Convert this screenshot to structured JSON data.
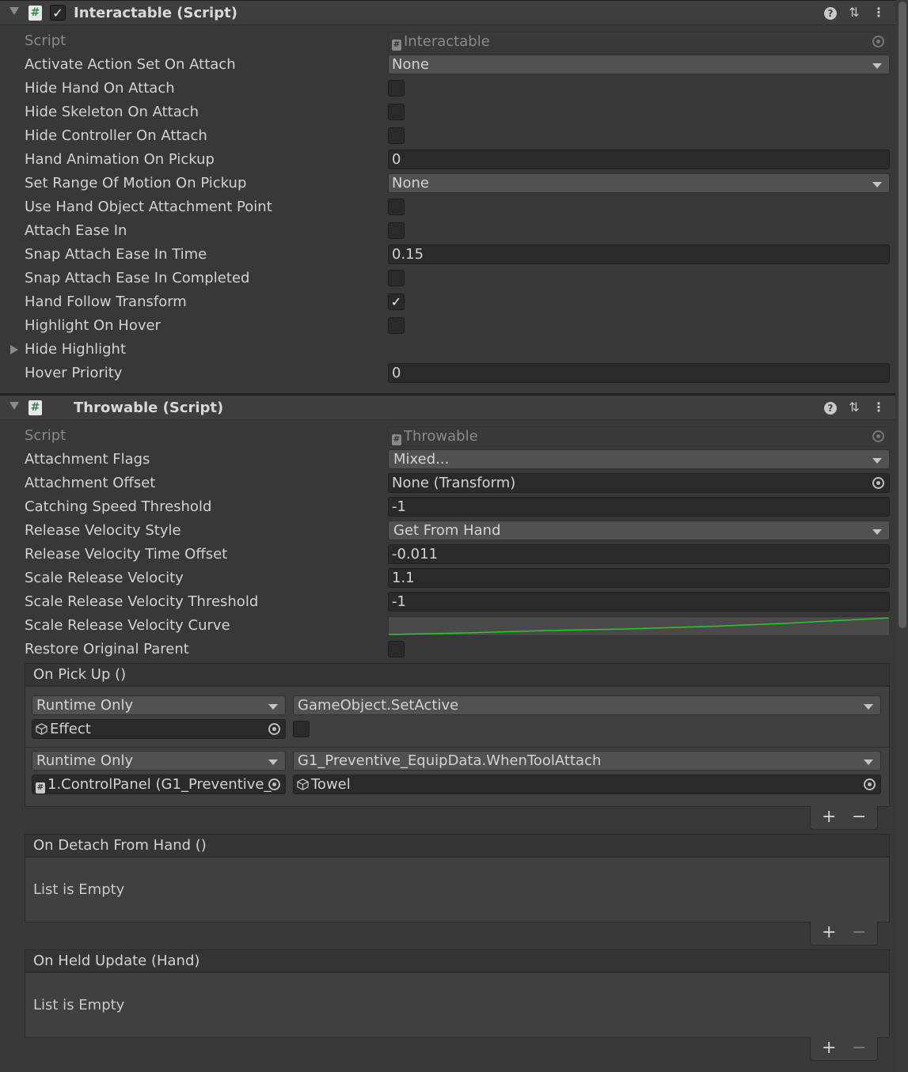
{
  "interactable": {
    "title": "Interactable (Script)",
    "enabled": true,
    "script_label": "Script",
    "script_value": "Interactable",
    "fields": [
      {
        "label": "Activate Action Set On Attach",
        "kind": "dropdown",
        "value": "None"
      },
      {
        "label": "Hide Hand On Attach",
        "kind": "checkbox",
        "checked": false
      },
      {
        "label": "Hide Skeleton On Attach",
        "kind": "checkbox",
        "checked": false
      },
      {
        "label": "Hide Controller On Attach",
        "kind": "checkbox",
        "checked": false
      },
      {
        "label": "Hand Animation On Pickup",
        "kind": "text",
        "value": "0"
      },
      {
        "label": "Set Range Of Motion On Pickup",
        "kind": "dropdown",
        "value": "None"
      },
      {
        "label": "Use Hand Object Attachment Point",
        "kind": "checkbox",
        "checked": false
      },
      {
        "label": "Attach Ease In",
        "kind": "checkbox",
        "checked": false
      },
      {
        "label": "Snap Attach Ease In Time",
        "kind": "text",
        "value": "0.15"
      },
      {
        "label": "Snap Attach Ease In Completed",
        "kind": "checkbox",
        "checked": false
      },
      {
        "label": "Hand Follow Transform",
        "kind": "checkbox",
        "checked": true
      },
      {
        "label": "Highlight On Hover",
        "kind": "checkbox",
        "checked": false
      },
      {
        "label": "Hide Highlight",
        "kind": "foldout"
      },
      {
        "label": "Hover Priority",
        "kind": "text",
        "value": "0"
      }
    ]
  },
  "throwable": {
    "title": "Throwable (Script)",
    "script_label": "Script",
    "script_value": "Throwable",
    "fields": [
      {
        "label": "Attachment Flags",
        "kind": "dropdown",
        "value": "Mixed..."
      },
      {
        "label": "Attachment Offset",
        "kind": "object",
        "value": "None (Transform)"
      },
      {
        "label": "Catching Speed Threshold",
        "kind": "text",
        "value": "-1"
      },
      {
        "label": "Release Velocity Style",
        "kind": "dropdown",
        "value": "Get From Hand"
      },
      {
        "label": "Release Velocity Time Offset",
        "kind": "text",
        "value": "-0.011"
      },
      {
        "label": "Scale Release Velocity",
        "kind": "text",
        "value": "1.1"
      },
      {
        "label": "Scale Release Velocity Threshold",
        "kind": "text",
        "value": "-1"
      },
      {
        "label": "Scale Release Velocity Curve",
        "kind": "curve"
      },
      {
        "label": "Restore Original Parent",
        "kind": "checkbox",
        "checked": false
      }
    ],
    "on_pick_up": {
      "title": "On Pick Up ()",
      "entries": [
        {
          "mode": "Runtime Only",
          "function": "GameObject.SetActive",
          "target": "Effect",
          "arg_kind": "checkbox"
        },
        {
          "mode": "Runtime Only",
          "function": "G1_Preventive_EquipData.WhenToolAttach",
          "target": "1.ControlPanel (G1_Preventive_",
          "arg": "Towel"
        }
      ]
    },
    "on_detach": {
      "title": "On Detach From Hand ()",
      "empty": "List is Empty"
    },
    "on_held_update": {
      "title": "On Held Update (Hand)",
      "empty": "List is Empty"
    },
    "plus": "+",
    "minus": "−"
  },
  "icons": {
    "script": "#",
    "check": "✓",
    "help": "?",
    "presets": "⇅",
    "menu": "⋮"
  },
  "colors": {
    "background": "#383838",
    "field": "#2a2a2a",
    "curve": "#1fd11f"
  }
}
